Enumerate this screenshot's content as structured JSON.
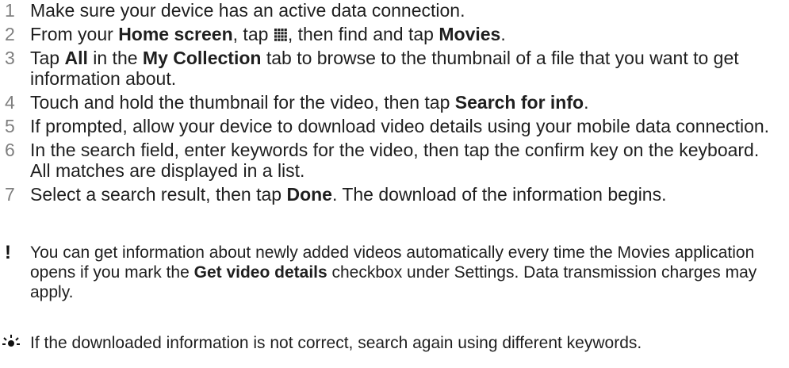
{
  "steps": [
    {
      "num": "1",
      "parts": [
        {
          "t": "Make sure your device has an active data connection."
        }
      ]
    },
    {
      "num": "2",
      "parts": [
        {
          "t": "From your "
        },
        {
          "t": "Home screen",
          "b": true
        },
        {
          "t": ", tap "
        },
        {
          "icon": "apps-grid-icon"
        },
        {
          "t": ", then find and tap "
        },
        {
          "t": "Movies",
          "b": true
        },
        {
          "t": "."
        }
      ]
    },
    {
      "num": "3",
      "parts": [
        {
          "t": "Tap "
        },
        {
          "t": "All",
          "b": true
        },
        {
          "t": " in the "
        },
        {
          "t": "My Collection",
          "b": true
        },
        {
          "t": " tab to browse to the thumbnail of a file that you want to get information about."
        }
      ]
    },
    {
      "num": "4",
      "parts": [
        {
          "t": "Touch and hold the thumbnail for the video, then tap "
        },
        {
          "t": "Search for info",
          "b": true
        },
        {
          "t": "."
        }
      ]
    },
    {
      "num": "5",
      "parts": [
        {
          "t": "If prompted, allow your device to download video details using your mobile data connection."
        }
      ]
    },
    {
      "num": "6",
      "parts": [
        {
          "t": "In the search field, enter keywords for the video, then tap the confirm key on the keyboard. All matches are displayed in a list."
        }
      ]
    },
    {
      "num": "7",
      "parts": [
        {
          "t": "Select a search result, then tap "
        },
        {
          "t": "Done",
          "b": true
        },
        {
          "t": ". The download of the information begins."
        }
      ]
    }
  ],
  "note": {
    "icon": "exclamation-icon",
    "symbol": "!",
    "parts": [
      {
        "t": "You can get information about newly added videos automatically every time the Movies application opens if you mark the "
      },
      {
        "t": "Get video details",
        "b": true
      },
      {
        "t": " checkbox under Settings. Data transmission charges may apply."
      }
    ]
  },
  "tip": {
    "icon": "lightbulb-icon",
    "text": "If the downloaded information is not correct, search again using different keywords."
  }
}
